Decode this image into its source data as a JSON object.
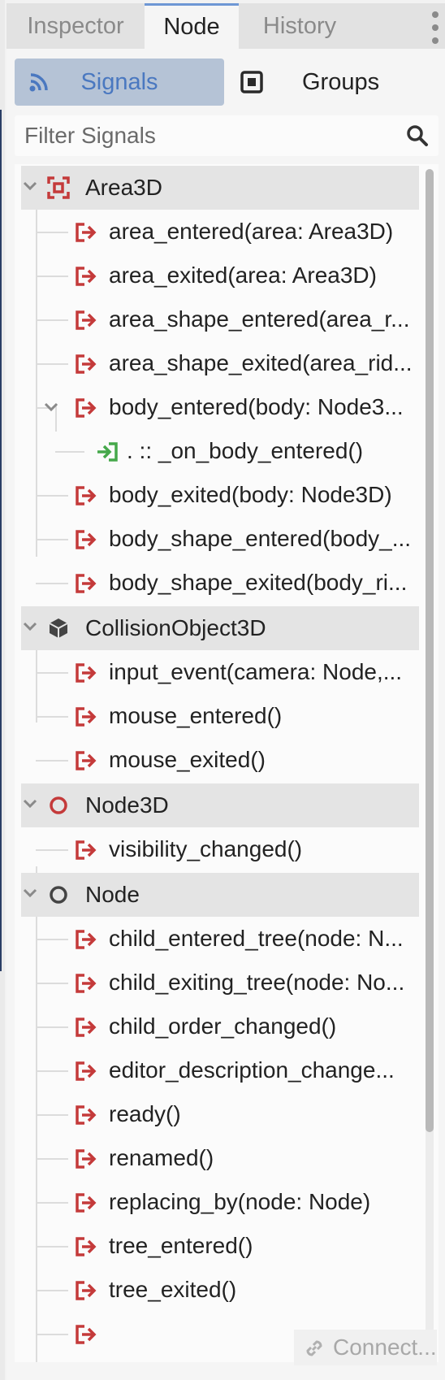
{
  "tabs": [
    {
      "label": "Inspector",
      "active": false
    },
    {
      "label": "Node",
      "active": true
    },
    {
      "label": "History",
      "active": false
    }
  ],
  "mode_toggle": {
    "signals_label": "Signals",
    "groups_label": "Groups",
    "selected": "Signals"
  },
  "filter": {
    "placeholder": "Filter Signals",
    "value": ""
  },
  "tree": {
    "sections": [
      {
        "class_name": "Area3D",
        "icon": "area3d-icon",
        "expanded": true,
        "signals": [
          {
            "label": "area_entered(area: Area3D)"
          },
          {
            "label": "area_exited(area: Area3D)"
          },
          {
            "label": "area_shape_entered(area_r..."
          },
          {
            "label": "area_shape_exited(area_rid..."
          },
          {
            "label": "body_entered(body: Node3...",
            "expanded": true,
            "connections": [
              ". :: _on_body_entered()"
            ]
          },
          {
            "label": "body_exited(body: Node3D)"
          },
          {
            "label": "body_shape_entered(body_..."
          },
          {
            "label": "body_shape_exited(body_ri..."
          }
        ]
      },
      {
        "class_name": "CollisionObject3D",
        "icon": "collision-object3d-icon",
        "expanded": true,
        "signals": [
          {
            "label": "input_event(camera: Node,..."
          },
          {
            "label": "mouse_entered()"
          },
          {
            "label": "mouse_exited()"
          }
        ]
      },
      {
        "class_name": "Node3D",
        "icon": "node3d-icon",
        "expanded": true,
        "signals": [
          {
            "label": "visibility_changed()"
          }
        ]
      },
      {
        "class_name": "Node",
        "icon": "node-icon",
        "expanded": true,
        "signals": [
          {
            "label": "child_entered_tree(node: N..."
          },
          {
            "label": "child_exiting_tree(node: No..."
          },
          {
            "label": "child_order_changed()"
          },
          {
            "label": "editor_description_change..."
          },
          {
            "label": "ready()"
          },
          {
            "label": "renamed()"
          },
          {
            "label": "replacing_by(node: Node)"
          },
          {
            "label": "tree_entered()"
          },
          {
            "label": "tree_exited()"
          }
        ]
      }
    ]
  },
  "footer": {
    "connect_label": "Connect...",
    "connect_enabled": false
  },
  "colors": {
    "accent": "#6e97d4",
    "signal_icon": "#c43a3a",
    "connection_icon": "#45a84a",
    "selected_button_bg": "#b5c3d6",
    "section_bg": "#e4e4e4"
  }
}
